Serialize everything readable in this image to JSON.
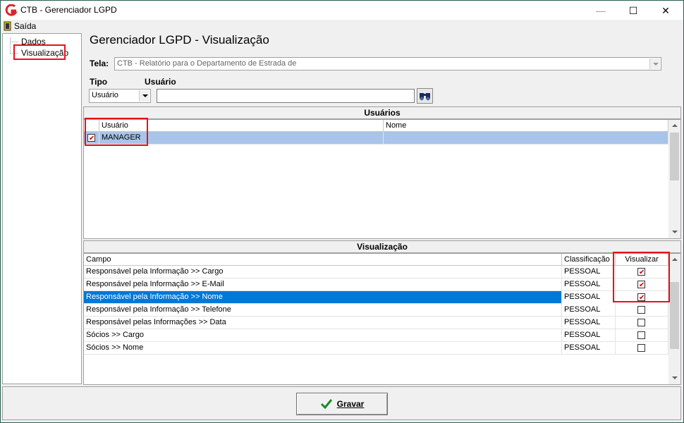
{
  "window": {
    "title": "CTB - Gerenciador LGPD",
    "minimize_glyph": "—",
    "maximize_glyph": "☐",
    "close_glyph": "✕"
  },
  "menu": {
    "saida_label": "Saída"
  },
  "tree": {
    "items": [
      {
        "label": "Dados"
      },
      {
        "label": "Visualização"
      }
    ]
  },
  "header": {
    "title": "Gerenciador LGPD - Visualização",
    "tela_label": "Tela:",
    "tela_value": "CTB - Relatório para o Departamento de Estrada de",
    "tipo_label": "Tipo",
    "usuario_label": "Usuário",
    "tipo_value": "Usuário",
    "usuario_value": ""
  },
  "usuarios": {
    "section_title": "Usuários",
    "columns": [
      "Usuário",
      "Nome"
    ],
    "rows": [
      {
        "checked": true,
        "usuario": "MANAGER",
        "nome": ""
      }
    ]
  },
  "visualizacao": {
    "section_title": "Visualização",
    "columns": [
      "Campo",
      "Classificação",
      "Visualizar"
    ],
    "rows": [
      {
        "campo": "Responsável pela Informação >> Cargo",
        "classificacao": "PESSOAL",
        "visualizar": true
      },
      {
        "campo": "Responsável pela Informação >> E-Mail",
        "classificacao": "PESSOAL",
        "visualizar": true
      },
      {
        "campo": "Responsável pela Informação >> Nome",
        "classificacao": "PESSOAL",
        "visualizar": true
      },
      {
        "campo": "Responsável pela Informação >> Telefone",
        "classificacao": "PESSOAL",
        "visualizar": false
      },
      {
        "campo": "Responsável pelas Informações >> Data",
        "classificacao": "PESSOAL",
        "visualizar": false
      },
      {
        "campo": "Sócios >> Cargo",
        "classificacao": "PESSOAL",
        "visualizar": false
      },
      {
        "campo": "Sócios >> Nome",
        "classificacao": "PESSOAL",
        "visualizar": false
      }
    ]
  },
  "footer": {
    "gravar_label": "Gravar"
  },
  "colors": {
    "selection": "#0078d7",
    "highlight_outline": "#e8111a",
    "titlebar_border": "#2b5f4f"
  }
}
